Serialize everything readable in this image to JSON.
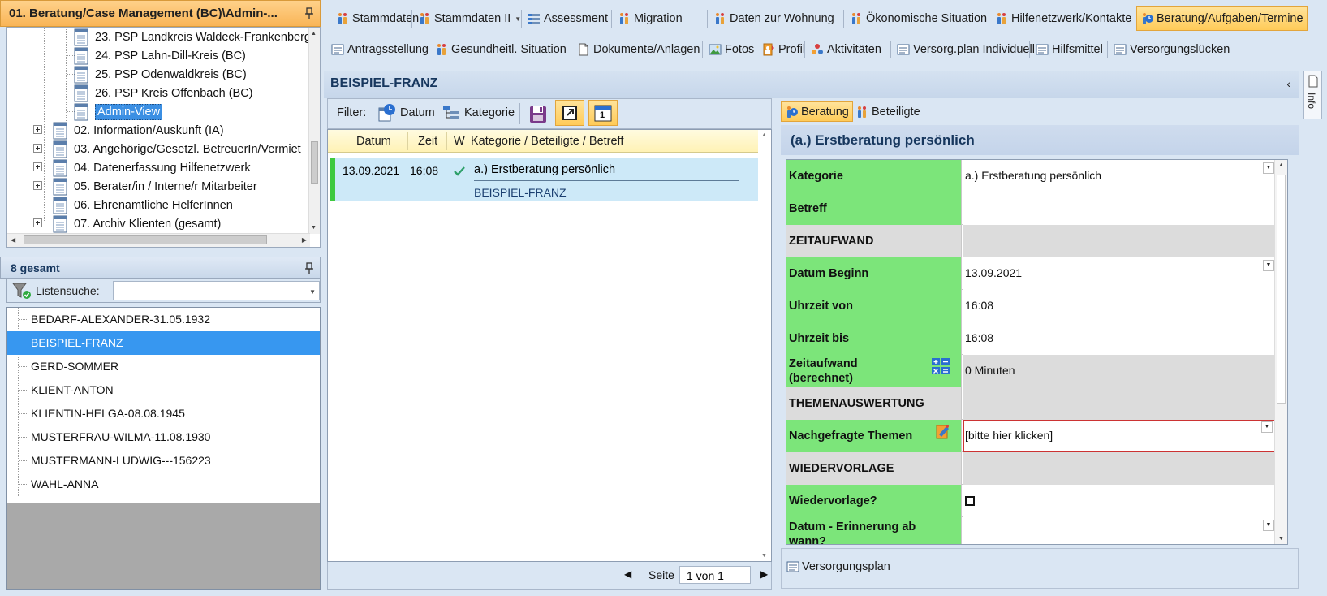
{
  "left_panel": {
    "header_title": "01. Beratung/Case Management (BC)\\Admin-...",
    "tree": {
      "items": [
        {
          "label": "23. PSP Landkreis Waldeck-Frankenberg"
        },
        {
          "label": "24. PSP Lahn-Dill-Kreis (BC)"
        },
        {
          "label": "25. PSP Odenwaldkreis (BC)"
        },
        {
          "label": "26. PSP Kreis Offenbach (BC)"
        },
        {
          "label": "Admin-View"
        },
        {
          "label": "02. Information/Auskunft (IA)"
        },
        {
          "label": "03. Angehörige/Gesetzl. BetreuerIn/Vermiet"
        },
        {
          "label": "04. Datenerfassung Hilfenetzwerk"
        },
        {
          "label": "05. Berater/in / Interne/r Mitarbeiter"
        },
        {
          "label": "06. Ehrenamtliche HelferInnen"
        },
        {
          "label": "07. Archiv Klienten (gesamt)"
        }
      ]
    },
    "list_header": "8 gesamt",
    "search_label": "Listensuche:",
    "clients": [
      {
        "name": "BEDARF-ALEXANDER-31.05.1932"
      },
      {
        "name": "BEISPIEL-FRANZ"
      },
      {
        "name": "GERD-SOMMER"
      },
      {
        "name": "KLIENT-ANTON"
      },
      {
        "name": "KLIENTIN-HELGA-08.08.1945"
      },
      {
        "name": "MUSTERFRAU-WILMA-11.08.1930"
      },
      {
        "name": "MUSTERMANN-LUDWIG---156223"
      },
      {
        "name": "WAHL-ANNA"
      }
    ]
  },
  "toolbar": {
    "row1": [
      {
        "label": "Stammdaten I"
      },
      {
        "label": "Stammdaten II"
      },
      {
        "label": "Assessment"
      },
      {
        "label": "Migration"
      },
      {
        "label": "Daten zur Wohnung"
      },
      {
        "label": "Ökonomische Situation"
      },
      {
        "label": "Hilfenetzwerk/Kontakte"
      },
      {
        "label": "Beratung/Aufgaben/Termine"
      }
    ],
    "row2": [
      {
        "label": "Antragsstellung"
      },
      {
        "label": "Gesundheitl. Situation"
      },
      {
        "label": "Dokumente/Anlagen"
      },
      {
        "label": "Fotos"
      },
      {
        "label": "Profil"
      },
      {
        "label": "Aktivitäten"
      },
      {
        "label": "Versorg.plan Individuell"
      },
      {
        "label": "Hilfsmittel"
      },
      {
        "label": "Versorgungslücken"
      }
    ]
  },
  "main": {
    "title": "BEISPIEL-FRANZ",
    "filter": {
      "label": "Filter:",
      "datum": "Datum",
      "kategorie": "Kategorie",
      "calendar_day": "1"
    },
    "grid": {
      "headers": {
        "datum": "Datum",
        "zeit": "Zeit",
        "w": "W",
        "kategorie": "Kategorie / Beteiligte / Betreff"
      },
      "row": {
        "datum": "13.09.2021",
        "zeit": "16:08",
        "kategorie": "a.) Erstberatung persönlich",
        "beteiligte": "BEISPIEL-FRANZ"
      }
    },
    "pager": {
      "label": "Seite",
      "value": "1 von 1"
    }
  },
  "detail": {
    "tabs": [
      {
        "label": "Beratung"
      },
      {
        "label": "Beteiligte"
      }
    ],
    "title": "(a.) Erstberatung persönlich",
    "rows": [
      {
        "label": "Kategorie",
        "value": "a.) Erstberatung persönlich"
      },
      {
        "label": "Betreff",
        "value": ""
      },
      {
        "label": "ZEITAUFWAND",
        "value": ""
      },
      {
        "label": "Datum Beginn",
        "value": "13.09.2021"
      },
      {
        "label": "Uhrzeit von",
        "value": "16:08"
      },
      {
        "label": "Uhrzeit bis",
        "value": "16:08"
      },
      {
        "label": "Zeitaufwand (berechnet)",
        "value": "0 Minuten"
      },
      {
        "label": "THEMENAUSWERTUNG",
        "value": ""
      },
      {
        "label": "Nachgefragte Themen",
        "value": "[bitte hier klicken]"
      },
      {
        "label": "WIEDERVORLAGE",
        "value": ""
      },
      {
        "label": "Wiedervorlage?",
        "value": ""
      },
      {
        "label": "Datum - Erinnerung ab wann?",
        "value": ""
      }
    ],
    "versorgungsplan": "Versorgungsplan",
    "info_tab": "Info"
  },
  "colors": {
    "accent_orange": "#ffcb58",
    "selection_blue": "#3797f0",
    "field_green": "#7ce57a",
    "header_navy": "#17375e"
  }
}
